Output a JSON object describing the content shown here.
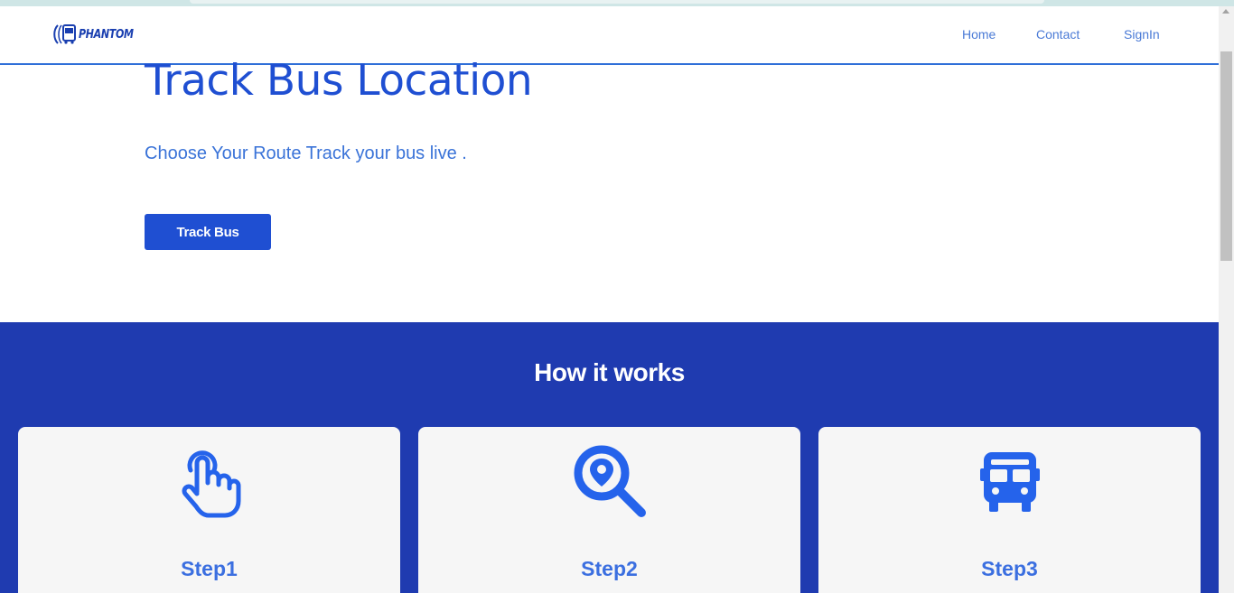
{
  "brand": {
    "logo_text": "PHANTOM",
    "color": "#1a3fb0"
  },
  "nav": {
    "home": "Home",
    "contact": "Contact",
    "signin": "SignIn"
  },
  "hero": {
    "title": "Track Bus Location",
    "subtitle": "Choose Your Route Track your bus live .",
    "button": "Track Bus"
  },
  "how": {
    "title": "How it works",
    "steps": [
      {
        "label": "Step1",
        "icon": "hand-pointer-icon"
      },
      {
        "label": "Step2",
        "icon": "location-search-icon"
      },
      {
        "label": "Step3",
        "icon": "bus-icon"
      }
    ]
  },
  "colors": {
    "accent": "#1f4fd2",
    "section_bg": "#1f3bb0",
    "icon": "#2563eb",
    "step_text": "#3b6fe0"
  }
}
